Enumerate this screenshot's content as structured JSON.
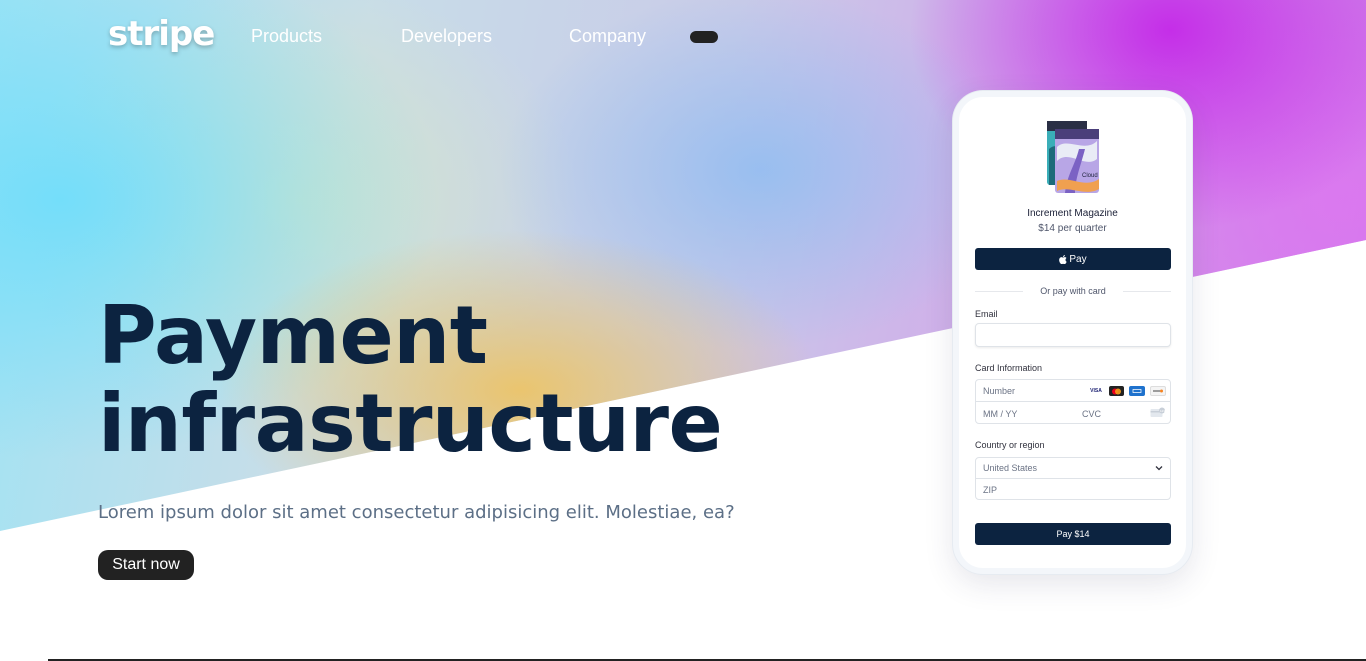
{
  "nav": {
    "logo": "stripe",
    "links": [
      "Products",
      "Developers",
      "Company"
    ]
  },
  "hero": {
    "headline_line1": "Payment",
    "headline_line2": "infrastructure",
    "subtext": "Lorem ipsum dolor sit amet consectetur adipisicing elit. Molestiae, ea?",
    "cta": "Start now"
  },
  "checkout": {
    "product_name": "Increment Magazine",
    "product_price": "$14 per quarter",
    "product_cover_text": "Cloud",
    "apple_pay_label": "Pay",
    "divider": "Or pay with card",
    "email_label": "Email",
    "email_value": "",
    "card_label": "Card Information",
    "card_number_placeholder": "Number",
    "card_expiry_placeholder": "MM / YY",
    "card_cvc_placeholder": "CVC",
    "card_brands": [
      "VISA",
      "mastercard-icon",
      "amex-icon",
      "discover-icon"
    ],
    "visa_text": "VISA",
    "country_label": "Country or region",
    "country_value": "United States",
    "zip_placeholder": "ZIP",
    "pay_button": "Pay $14"
  },
  "colors": {
    "headline": "#0c2340",
    "button_dark": "#222222",
    "checkout_button": "#0c2340",
    "gradient_magenta": "#c428e8",
    "gradient_cyan": "#74defa",
    "gradient_gold": "#ecc468"
  }
}
